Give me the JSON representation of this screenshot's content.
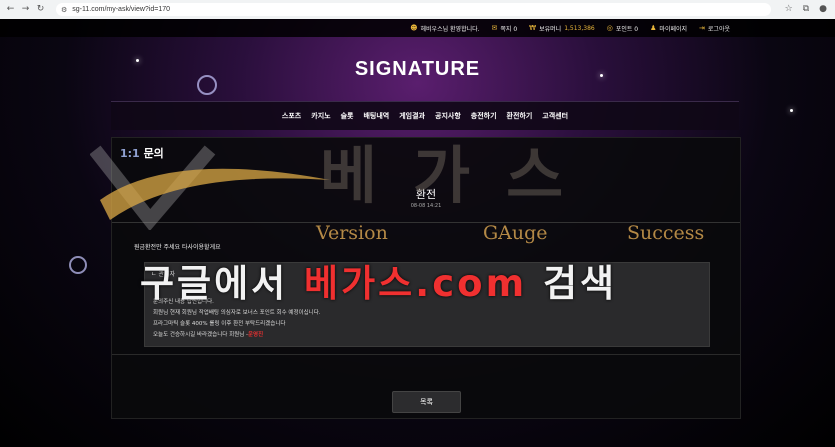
{
  "browser": {
    "url": "sg-11.com/my-ask/view?id=170"
  },
  "userbar": {
    "welcome": "헤비우스님 환영합니다.",
    "messages": "쪽지 0",
    "money_label": "보유머니",
    "money_value": "1,513,386",
    "points": "포인트 0",
    "mypage": "마이페이지",
    "logout": "로그아웃"
  },
  "site": {
    "logo": "SIGNATURE"
  },
  "menu": [
    "스포츠",
    "카지노",
    "슬롯",
    "배팅내역",
    "게임결과",
    "공지사항",
    "충전하기",
    "환전하기",
    "고객센터"
  ],
  "page": {
    "title_num": "1:1",
    "title_text": "문의",
    "subject": "환전",
    "date": "08-08 14:21",
    "question": "원금환전만 주세요 타사이용할게요",
    "answer_head": "관리자",
    "answer_lines": [
      "문의주신 내용 답변입니다.",
      "회원님 현재 회원님 작업배팅 의심자로 보너스 포인트 회수 예정이십니다.",
      "프라그마틱 슬롯 400% 롤링 이후 환전 부탁드리겠습니다",
      "오늘도 건승하시길 바라겠습니다 회원님 -"
    ],
    "answer_signature": "운영진",
    "list_button": "목록"
  },
  "watermark": {
    "brand": "베가스",
    "sub1": "Version",
    "sub2": "GAuge",
    "sub3": "Success",
    "search_prefix": "구글에서 ",
    "search_brand": "베가스.com",
    "search_suffix": " 검색"
  }
}
